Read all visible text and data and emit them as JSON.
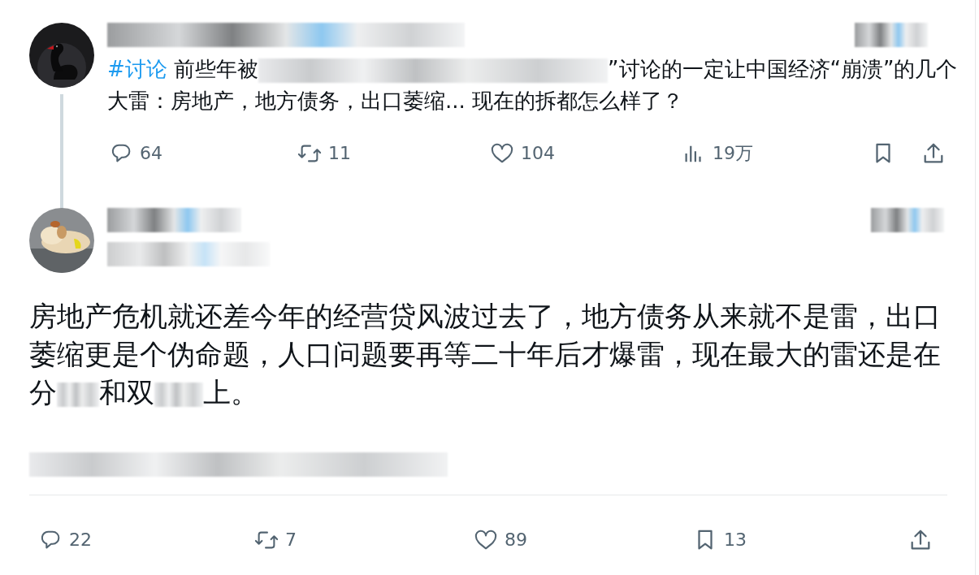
{
  "main_post": {
    "author_redacted": true,
    "time_redacted": true,
    "text": [
      {
        "kind": "hashtag",
        "text": "#讨论"
      },
      {
        "kind": "text",
        "text": " 前些年被"
      },
      {
        "kind": "redacted"
      },
      {
        "kind": "text",
        "text": "”讨论的一定让中国经济“崩溃”的几个大雷：房地产，地方债务，出口萎缩... 现在的拆都怎么样了？"
      }
    ],
    "actions": [
      {
        "kind": "reply",
        "count": "64"
      },
      {
        "kind": "repost",
        "count": "11"
      },
      {
        "kind": "like",
        "count": "104"
      },
      {
        "kind": "views",
        "count": "19万"
      },
      {
        "kind": "bookmark"
      },
      {
        "kind": "share"
      }
    ]
  },
  "reply": {
    "author_redacted": true,
    "time_redacted": true,
    "text": [
      {
        "kind": "text",
        "text": "房地产危机就还差今年的经营贷风波过去了，地方债务从来就不是雷，出口萎缩更是个伪命题，人口问题要再等二十年后才爆雷，现在最大的雷还是在分"
      },
      {
        "kind": "redacted"
      },
      {
        "kind": "text",
        "text": "和双"
      },
      {
        "kind": "redacted"
      },
      {
        "kind": "text",
        "text": "上。"
      }
    ],
    "actions": [
      {
        "kind": "reply",
        "count": "22"
      },
      {
        "kind": "repost",
        "count": "7"
      },
      {
        "kind": "like",
        "count": "89"
      },
      {
        "kind": "bookmark",
        "count": "13"
      },
      {
        "kind": "share"
      }
    ]
  }
}
